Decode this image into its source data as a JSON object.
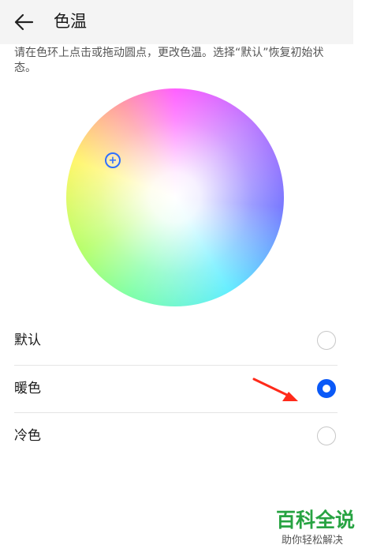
{
  "header": {
    "title": "色温"
  },
  "description": "请在色环上点击或拖动圆点，更改色温。选择“默认”恢复初始状态。",
  "options": [
    {
      "label": "默认",
      "selected": false
    },
    {
      "label": "暖色",
      "selected": true
    },
    {
      "label": "冷色",
      "selected": false
    }
  ],
  "colors": {
    "accent": "#0a59f7",
    "annotation_arrow": "#ff2a1a",
    "watermark": "#27a342"
  },
  "icons": {
    "back": "back-arrow-icon",
    "picker": "plus-icon"
  },
  "watermark": {
    "main": "百科全说",
    "sub": "助你轻松解决"
  }
}
